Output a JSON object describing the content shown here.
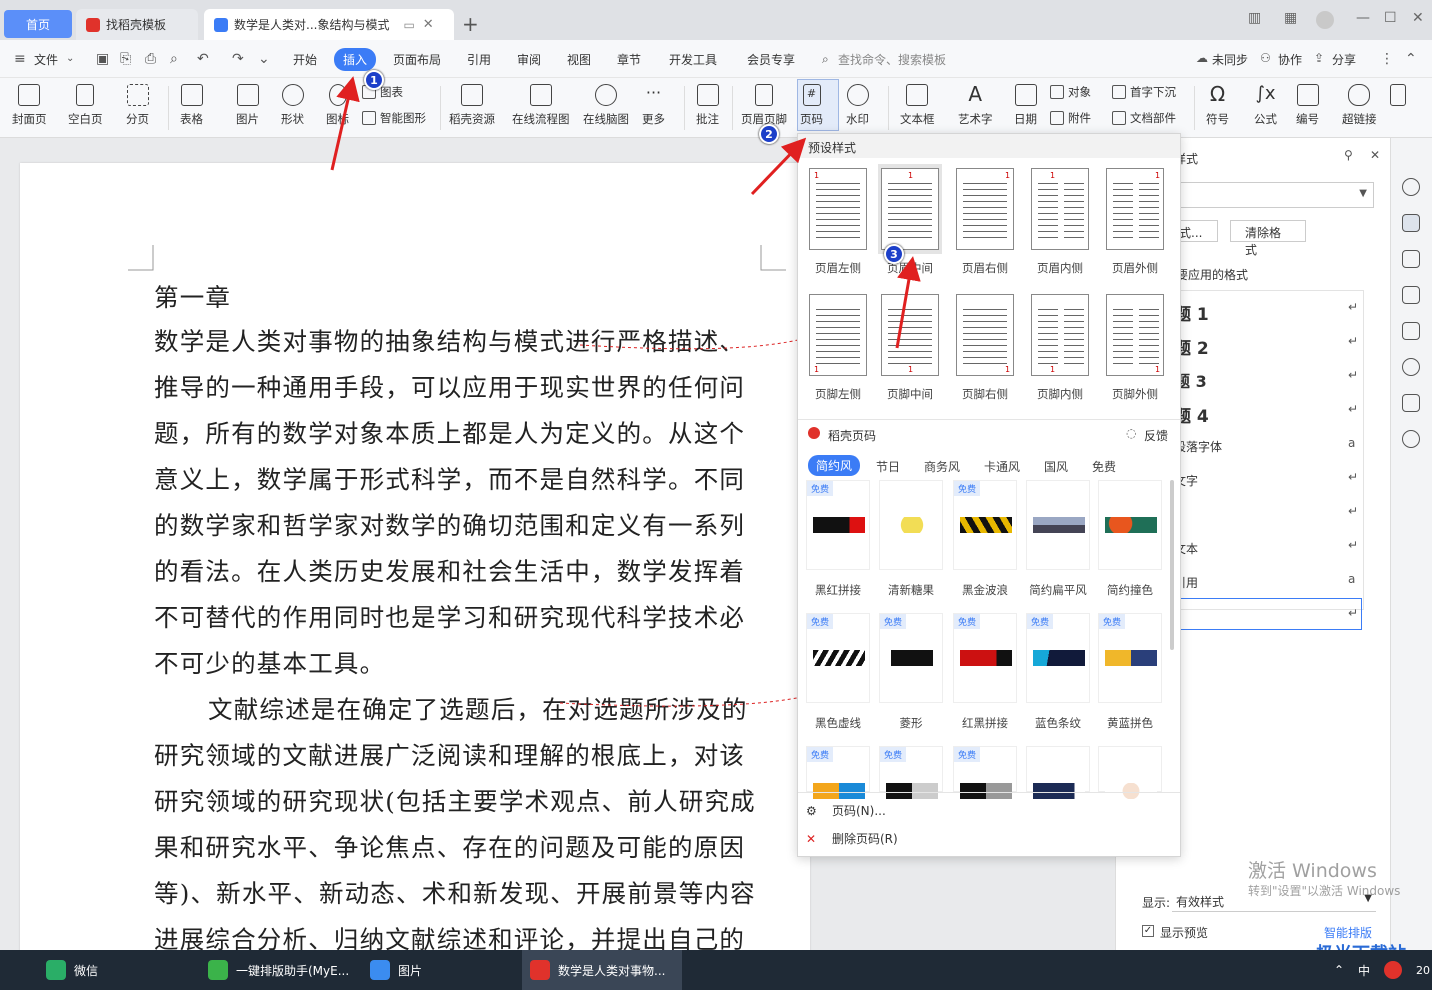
{
  "tabs": {
    "home": "首页",
    "docer": "找稻壳模板",
    "doc": "数学是人类对...象结构与模式",
    "add": "+"
  },
  "menu": {
    "file": "文件",
    "items": [
      "开始",
      "插入",
      "页面布局",
      "引用",
      "审阅",
      "视图",
      "章节",
      "开发工具",
      "会员专享"
    ],
    "search_placeholder": "查找命令、搜索模板",
    "unsynced": "未同步",
    "collab": "协作",
    "share": "分享"
  },
  "ribbon": {
    "buttons": [
      "封面页",
      "空白页",
      "分页",
      "表格",
      "图片",
      "形状",
      "图标",
      "稻壳资源",
      "在线流程图",
      "在线脑图",
      "更多",
      "批注",
      "页眉页脚",
      "页码",
      "水印",
      "文本框",
      "艺术字",
      "日期",
      "符号",
      "公式",
      "编号",
      "超链接"
    ],
    "small": {
      "chart": "图表",
      "smart_shape": "智能图形",
      "object": "对象",
      "dropcap": "首字下沉",
      "attachment": "附件",
      "doc_part": "文档部件"
    }
  },
  "document": {
    "lines": [
      "第一章",
      "数学是人类对事物的抽象结构与模式进行严格描述、",
      "推导的一种通用手段，可以应用于现实世界的任何问",
      "题，所有的数学对象本质上都是人为定义的。从这个",
      "意义上，数学属于形式科学，而不是自然科学。不同",
      "的数学家和哲学家对数学的确切范围和定义有一系列",
      "的看法。在人类历史发展和社会生活中，数学发挥着",
      "不可替代的作用同时也是学习和研究现代科学技术必",
      "不可少的基本工具。",
      "文献综述是在确定了选题后，在对选题所涉及的",
      "研究领域的文献进展广泛阅读和理解的根底上，对该",
      "研究领域的研究现状(包括主要学术观点、前人研究成",
      "果和研究水平、争论焦点、存在的问题及可能的原因",
      "等)、新水平、新动态、术和新发现、开展前景等内容",
      "进展综合分析、归纳文献综述和评论，并提出自己的"
    ]
  },
  "popup": {
    "preset_title": "预设样式",
    "presets_top": [
      "页眉左侧",
      "页眉中间",
      "页眉右侧",
      "页眉内侧",
      "页眉外侧"
    ],
    "presets_bottom": [
      "页脚左侧",
      "页脚中间",
      "页脚右侧",
      "页脚内侧",
      "页脚外侧"
    ],
    "docer_title": "稻壳页码",
    "feedback": "反馈",
    "categories": [
      "简约风",
      "节日",
      "商务风",
      "卡通风",
      "国风",
      "免费"
    ],
    "free_badge": "免费",
    "templates_row1": [
      "黑红拼接",
      "清新糖果",
      "黑金波浪",
      "简约扁平风",
      "简约撞色"
    ],
    "templates_row2": [
      "黑色虚线",
      "菱形",
      "红黑拼接",
      "蓝色条纹",
      "黄蓝拼色"
    ],
    "page_number_action": "页码(N)...",
    "delete_action": "删除页码(R)"
  },
  "right_panel": {
    "title_partial": "样式",
    "new_style": "式...",
    "clear_format": "清除格式",
    "apply_title": "要应用的格式",
    "styles": [
      "题 1",
      "题 2",
      "题 3",
      "题 4",
      "段落字体",
      "文字",
      "",
      "文本",
      "引用"
    ],
    "display_label": "显示:",
    "display_value": "有效样式",
    "preview_label": "显示预览",
    "smart_layout": "智能排版"
  },
  "markers": [
    "1",
    "2",
    "3"
  ],
  "watermark": {
    "line1": "激活 Windows",
    "line2": "转到\"设置\"以激活 Windows",
    "site": "极光下载站"
  },
  "taskbar": {
    "items": [
      "微信",
      "一键排版助手(MyE...",
      "图片",
      "数学是人类对事物..."
    ],
    "ime": "中",
    "clock": "20"
  },
  "colors": {
    "accent": "#3b7cf6",
    "arrow": "#e02020",
    "marker": "#1c3fc9",
    "taskbar": "#1f2a36"
  }
}
